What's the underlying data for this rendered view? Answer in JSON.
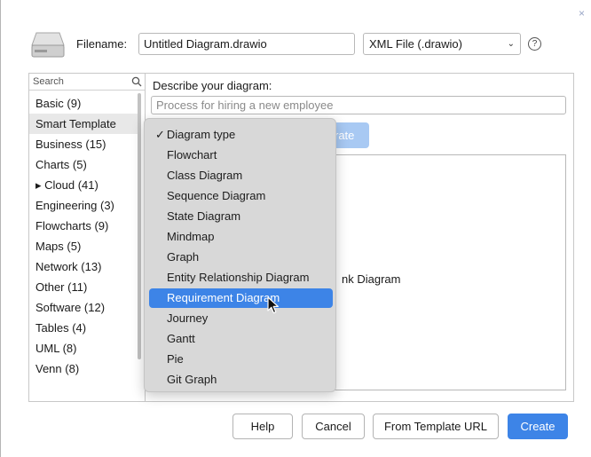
{
  "header": {
    "close_symbol": "×",
    "filename_label": "Filename:",
    "filename_value": "Untitled Diagram.drawio",
    "format_value": "XML File (.drawio)",
    "help_symbol": "?"
  },
  "sidebar": {
    "search_placeholder": "Search",
    "items": [
      {
        "label": "Basic (9)"
      },
      {
        "label": "Smart Template"
      },
      {
        "label": "Business (15)"
      },
      {
        "label": "Charts (5)"
      },
      {
        "label": "▸ Cloud (41)"
      },
      {
        "label": "Engineering (3)"
      },
      {
        "label": "Flowcharts (9)"
      },
      {
        "label": "Maps (5)"
      },
      {
        "label": "Network (13)"
      },
      {
        "label": "Other (11)"
      },
      {
        "label": "Software (12)"
      },
      {
        "label": "Tables (4)"
      },
      {
        "label": "UML (8)"
      },
      {
        "label": "Venn (8)"
      }
    ],
    "selected_index": 1
  },
  "main": {
    "describe_label": "Describe your diagram:",
    "describe_placeholder": "Process for hiring a new employee",
    "generate_partial": "rate",
    "preview_partial": "nk Diagram"
  },
  "menu": {
    "items": [
      {
        "label": "Diagram type",
        "checked": true
      },
      {
        "label": "Flowchart"
      },
      {
        "label": "Class Diagram"
      },
      {
        "label": "Sequence Diagram"
      },
      {
        "label": "State Diagram"
      },
      {
        "label": "Mindmap"
      },
      {
        "label": "Graph"
      },
      {
        "label": "Entity Relationship Diagram"
      },
      {
        "label": "Requirement Diagram",
        "highlighted": true
      },
      {
        "label": "Journey"
      },
      {
        "label": "Gantt"
      },
      {
        "label": "Pie"
      },
      {
        "label": "Git Graph"
      }
    ]
  },
  "footer": {
    "help": "Help",
    "cancel": "Cancel",
    "template_url": "From Template URL",
    "create": "Create"
  },
  "colors": {
    "accent": "#3d84e7",
    "accent_disabled": "#a8c9f3",
    "menu_background": "#d8d8d8",
    "selected_row": "#e8e8e8"
  },
  "icons": {
    "disk": "hard-drive-icon",
    "search": "search-icon",
    "help": "help-circle-icon",
    "chevron": "chevron-down-icon",
    "check": "checkmark-icon",
    "close": "close-icon",
    "cursor": "mouse-pointer-icon"
  }
}
